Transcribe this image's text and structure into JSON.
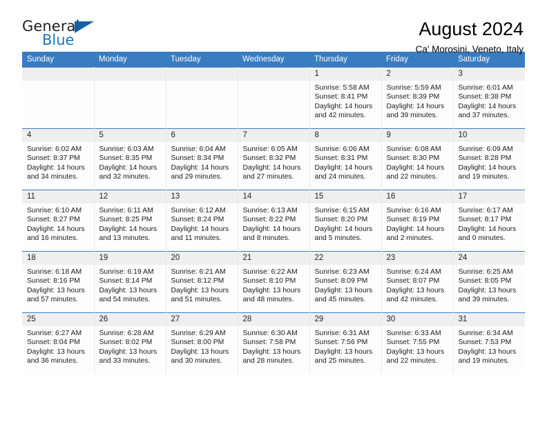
{
  "brand": {
    "name_part1": "General",
    "name_part2": "Blue",
    "accent_color": "#1b75bb",
    "triangle_color": "#1361a8"
  },
  "header": {
    "title": "August 2024",
    "subtitle": "Ca' Morosini, Veneto, Italy"
  },
  "calendar": {
    "header_bg": "#3a7cc0",
    "weekdays": [
      "Sunday",
      "Monday",
      "Tuesday",
      "Wednesday",
      "Thursday",
      "Friday",
      "Saturday"
    ],
    "weeks": [
      [
        {
          "day": "",
          "empty": true
        },
        {
          "day": "",
          "empty": true
        },
        {
          "day": "",
          "empty": true
        },
        {
          "day": "",
          "empty": true
        },
        {
          "day": "1",
          "sunrise": "Sunrise: 5:58 AM",
          "sunset": "Sunset: 8:41 PM",
          "daylight": "Daylight: 14 hours and 42 minutes."
        },
        {
          "day": "2",
          "sunrise": "Sunrise: 5:59 AM",
          "sunset": "Sunset: 8:39 PM",
          "daylight": "Daylight: 14 hours and 39 minutes."
        },
        {
          "day": "3",
          "sunrise": "Sunrise: 6:01 AM",
          "sunset": "Sunset: 8:38 PM",
          "daylight": "Daylight: 14 hours and 37 minutes."
        }
      ],
      [
        {
          "day": "4",
          "sunrise": "Sunrise: 6:02 AM",
          "sunset": "Sunset: 8:37 PM",
          "daylight": "Daylight: 14 hours and 34 minutes."
        },
        {
          "day": "5",
          "sunrise": "Sunrise: 6:03 AM",
          "sunset": "Sunset: 8:35 PM",
          "daylight": "Daylight: 14 hours and 32 minutes."
        },
        {
          "day": "6",
          "sunrise": "Sunrise: 6:04 AM",
          "sunset": "Sunset: 8:34 PM",
          "daylight": "Daylight: 14 hours and 29 minutes."
        },
        {
          "day": "7",
          "sunrise": "Sunrise: 6:05 AM",
          "sunset": "Sunset: 8:32 PM",
          "daylight": "Daylight: 14 hours and 27 minutes."
        },
        {
          "day": "8",
          "sunrise": "Sunrise: 6:06 AM",
          "sunset": "Sunset: 8:31 PM",
          "daylight": "Daylight: 14 hours and 24 minutes."
        },
        {
          "day": "9",
          "sunrise": "Sunrise: 6:08 AM",
          "sunset": "Sunset: 8:30 PM",
          "daylight": "Daylight: 14 hours and 22 minutes."
        },
        {
          "day": "10",
          "sunrise": "Sunrise: 6:09 AM",
          "sunset": "Sunset: 8:28 PM",
          "daylight": "Daylight: 14 hours and 19 minutes."
        }
      ],
      [
        {
          "day": "11",
          "sunrise": "Sunrise: 6:10 AM",
          "sunset": "Sunset: 8:27 PM",
          "daylight": "Daylight: 14 hours and 16 minutes."
        },
        {
          "day": "12",
          "sunrise": "Sunrise: 6:11 AM",
          "sunset": "Sunset: 8:25 PM",
          "daylight": "Daylight: 14 hours and 13 minutes."
        },
        {
          "day": "13",
          "sunrise": "Sunrise: 6:12 AM",
          "sunset": "Sunset: 8:24 PM",
          "daylight": "Daylight: 14 hours and 11 minutes."
        },
        {
          "day": "14",
          "sunrise": "Sunrise: 6:13 AM",
          "sunset": "Sunset: 8:22 PM",
          "daylight": "Daylight: 14 hours and 8 minutes."
        },
        {
          "day": "15",
          "sunrise": "Sunrise: 6:15 AM",
          "sunset": "Sunset: 8:20 PM",
          "daylight": "Daylight: 14 hours and 5 minutes."
        },
        {
          "day": "16",
          "sunrise": "Sunrise: 6:16 AM",
          "sunset": "Sunset: 8:19 PM",
          "daylight": "Daylight: 14 hours and 2 minutes."
        },
        {
          "day": "17",
          "sunrise": "Sunrise: 6:17 AM",
          "sunset": "Sunset: 8:17 PM",
          "daylight": "Daylight: 14 hours and 0 minutes."
        }
      ],
      [
        {
          "day": "18",
          "sunrise": "Sunrise: 6:18 AM",
          "sunset": "Sunset: 8:16 PM",
          "daylight": "Daylight: 13 hours and 57 minutes."
        },
        {
          "day": "19",
          "sunrise": "Sunrise: 6:19 AM",
          "sunset": "Sunset: 8:14 PM",
          "daylight": "Daylight: 13 hours and 54 minutes."
        },
        {
          "day": "20",
          "sunrise": "Sunrise: 6:21 AM",
          "sunset": "Sunset: 8:12 PM",
          "daylight": "Daylight: 13 hours and 51 minutes."
        },
        {
          "day": "21",
          "sunrise": "Sunrise: 6:22 AM",
          "sunset": "Sunset: 8:10 PM",
          "daylight": "Daylight: 13 hours and 48 minutes."
        },
        {
          "day": "22",
          "sunrise": "Sunrise: 6:23 AM",
          "sunset": "Sunset: 8:09 PM",
          "daylight": "Daylight: 13 hours and 45 minutes."
        },
        {
          "day": "23",
          "sunrise": "Sunrise: 6:24 AM",
          "sunset": "Sunset: 8:07 PM",
          "daylight": "Daylight: 13 hours and 42 minutes."
        },
        {
          "day": "24",
          "sunrise": "Sunrise: 6:25 AM",
          "sunset": "Sunset: 8:05 PM",
          "daylight": "Daylight: 13 hours and 39 minutes."
        }
      ],
      [
        {
          "day": "25",
          "sunrise": "Sunrise: 6:27 AM",
          "sunset": "Sunset: 8:04 PM",
          "daylight": "Daylight: 13 hours and 36 minutes."
        },
        {
          "day": "26",
          "sunrise": "Sunrise: 6:28 AM",
          "sunset": "Sunset: 8:02 PM",
          "daylight": "Daylight: 13 hours and 33 minutes."
        },
        {
          "day": "27",
          "sunrise": "Sunrise: 6:29 AM",
          "sunset": "Sunset: 8:00 PM",
          "daylight": "Daylight: 13 hours and 30 minutes."
        },
        {
          "day": "28",
          "sunrise": "Sunrise: 6:30 AM",
          "sunset": "Sunset: 7:58 PM",
          "daylight": "Daylight: 13 hours and 28 minutes."
        },
        {
          "day": "29",
          "sunrise": "Sunrise: 6:31 AM",
          "sunset": "Sunset: 7:56 PM",
          "daylight": "Daylight: 13 hours and 25 minutes."
        },
        {
          "day": "30",
          "sunrise": "Sunrise: 6:33 AM",
          "sunset": "Sunset: 7:55 PM",
          "daylight": "Daylight: 13 hours and 22 minutes."
        },
        {
          "day": "31",
          "sunrise": "Sunrise: 6:34 AM",
          "sunset": "Sunset: 7:53 PM",
          "daylight": "Daylight: 13 hours and 19 minutes."
        }
      ]
    ]
  }
}
